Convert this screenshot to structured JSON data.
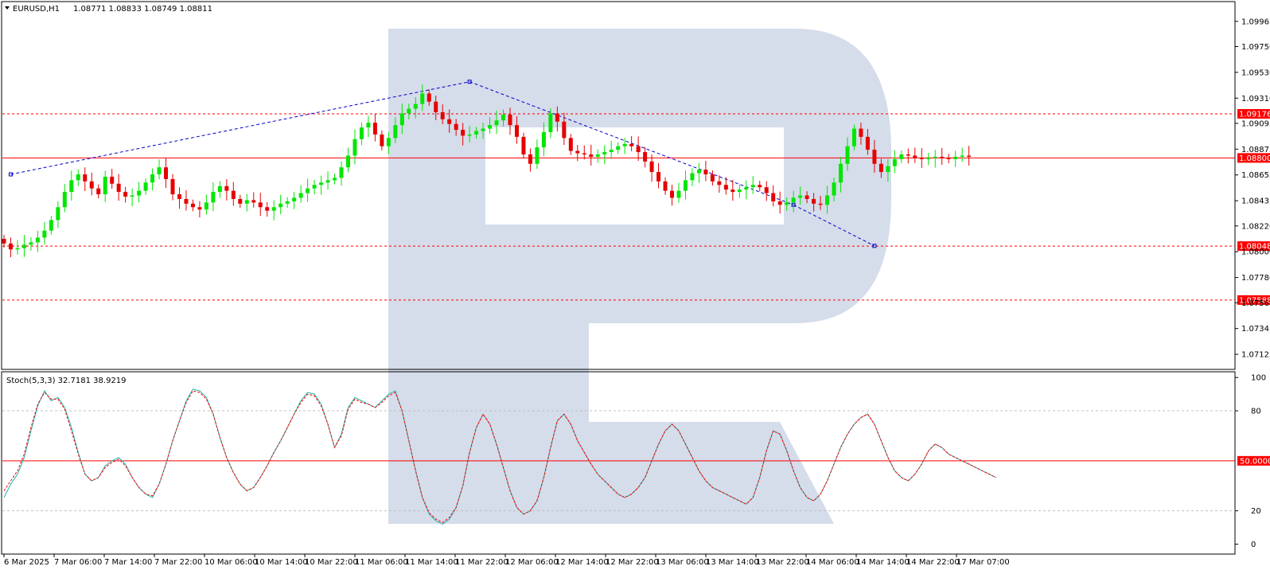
{
  "header": {
    "symbol": "EURUSD,H1",
    "ohlc": "1.08771 1.08833 1.08749 1.08811"
  },
  "stoch_header": "Stoch(5,3,3) 32.7181 38.9219",
  "colors": {
    "bull": "#00e600",
    "bear": "#e60000",
    "hline": "#ff0000",
    "pattern": "#0000cc",
    "stoch_main": "#20b2aa",
    "stoch_signal": "#ff0000",
    "watermark": "#d5dcea"
  },
  "chart_data": [
    {
      "type": "candlestick",
      "symbol": "EURUSD",
      "timeframe": "H1",
      "ylim": [
        1.0701,
        1.1012
      ],
      "yticks": [
        "1.09965",
        "1.09750",
        "1.09530",
        "1.09310",
        "1.09095",
        "1.08875",
        "1.08655",
        "1.08435",
        "1.08220",
        "1.08000",
        "1.07780",
        "1.07565",
        "1.07345",
        "1.07125"
      ],
      "xticks": [
        "6 Mar 2025",
        "7 Mar 06:00",
        "7 Mar 14:00",
        "7 Mar 22:00",
        "10 Mar 06:00",
        "10 Mar 14:00",
        "10 Mar 22:00",
        "11 Mar 06:00",
        "11 Mar 14:00",
        "11 Mar 22:00",
        "12 Mar 06:00",
        "12 Mar 14:00",
        "12 Mar 22:00",
        "13 Mar 06:00",
        "13 Mar 14:00",
        "13 Mar 22:00",
        "14 Mar 06:00",
        "14 Mar 14:00",
        "14 Mar 22:00",
        "17 Mar 07:00"
      ],
      "price_levels": [
        {
          "value": 1.09176,
          "label": "1.09176",
          "style": "dashed"
        },
        {
          "value": 1.088,
          "label": "1.08800",
          "style": "solid"
        },
        {
          "value": 1.08048,
          "label": "1.08048",
          "style": "dashed"
        },
        {
          "value": 1.07588,
          "label": "1.07588",
          "style": "dashed"
        }
      ],
      "pattern_points": [
        {
          "pt": [
            1,
            1.0866
          ],
          "style": "dashed"
        },
        {
          "pt": [
            69,
            1.0945
          ],
          "style": "dashed"
        },
        {
          "pt": [
            117,
            1.084
          ],
          "style": "dashed"
        },
        {
          "pt": [
            129,
            1.0805
          ],
          "style": "dashed"
        }
      ],
      "close_series": [
        1.0807,
        1.0802,
        1.0803,
        1.0806,
        1.0808,
        1.0812,
        1.0818,
        1.0827,
        1.0838,
        1.0851,
        1.0861,
        1.0866,
        1.086,
        1.0854,
        1.0849,
        1.0864,
        1.0858,
        1.0851,
        1.0847,
        1.0848,
        1.0852,
        1.0859,
        1.0866,
        1.0872,
        1.0862,
        1.0849,
        1.0845,
        1.0841,
        1.0838,
        1.0836,
        1.0842,
        1.0851,
        1.0856,
        1.0852,
        1.0845,
        1.0841,
        1.0844,
        1.0842,
        1.0838,
        1.0835,
        1.0838,
        1.0841,
        1.0843,
        1.0846,
        1.085,
        1.0854,
        1.0857,
        1.0859,
        1.0861,
        1.0863,
        1.0872,
        1.0882,
        1.0896,
        1.0906,
        1.091,
        1.09,
        1.089,
        1.0897,
        1.0908,
        1.0918,
        1.0922,
        1.0926,
        1.0935,
        1.0928,
        1.0919,
        1.0913,
        1.0909,
        1.0904,
        1.0899,
        1.09,
        1.0903,
        1.0905,
        1.0908,
        1.0912,
        1.0917,
        1.0908,
        1.0898,
        1.0883,
        1.0875,
        1.0889,
        1.0902,
        1.0918,
        1.0911,
        1.0897,
        1.0886,
        1.0884,
        1.0883,
        1.0881,
        1.0883,
        1.0885,
        1.0887,
        1.089,
        1.0892,
        1.089,
        1.0885,
        1.0877,
        1.0868,
        1.086,
        1.0852,
        1.0846,
        1.0852,
        1.0861,
        1.0867,
        1.087,
        1.0866,
        1.086,
        1.0857,
        1.0853,
        1.0851,
        1.0853,
        1.0855,
        1.0857,
        1.0855,
        1.085,
        1.0843,
        1.084,
        1.0842,
        1.0846,
        1.0848,
        1.0845,
        1.0841,
        1.084,
        1.0848,
        1.0859,
        1.0875,
        1.089,
        1.0905,
        1.0898,
        1.0887,
        1.0875,
        1.0868,
        1.0873,
        1.0879,
        1.0883,
        1.0882,
        1.088,
        1.0879,
        1.088,
        1.0881,
        1.088,
        1.0879,
        1.0881,
        1.0882,
        1.0881
      ]
    },
    {
      "type": "line",
      "title": "Stoch(5,3,3) 32.7181 38.9219",
      "ylim": [
        -5,
        102
      ],
      "yticks": [
        "100",
        "80",
        "20",
        "0"
      ],
      "levels": [
        {
          "value": 80,
          "style": "dashed"
        },
        {
          "value": 50,
          "label": "50.0000",
          "style": "solid"
        },
        {
          "value": 20,
          "style": "dashed"
        }
      ],
      "series": [
        {
          "values": [
            28,
            36,
            42,
            52,
            68,
            83,
            92,
            86,
            88,
            82,
            70,
            55,
            42,
            38,
            40,
            47,
            50,
            52,
            48,
            40,
            34,
            30,
            28,
            36,
            48,
            62,
            74,
            86,
            93,
            92,
            88,
            78,
            64,
            52,
            43,
            36,
            32,
            34,
            40,
            47,
            55,
            62,
            70,
            78,
            86,
            91,
            90,
            84,
            72,
            58,
            66,
            82,
            88,
            86,
            84,
            82,
            86,
            90,
            92,
            80,
            62,
            44,
            28,
            18,
            14,
            12,
            15,
            22,
            35,
            55,
            70,
            78,
            72,
            60,
            46,
            32,
            22,
            18,
            20,
            26,
            40,
            58,
            74,
            78,
            72,
            62,
            55,
            48,
            42,
            38,
            34,
            30,
            28,
            30,
            34,
            40,
            50,
            60,
            68,
            72,
            68,
            60,
            52,
            44,
            38,
            34,
            32,
            30,
            28,
            26,
            24,
            28,
            40,
            56,
            68,
            66,
            56,
            44,
            34,
            28,
            26,
            30,
            38,
            48,
            58,
            66,
            72,
            76,
            78,
            72,
            62,
            52,
            44,
            40,
            38,
            42,
            48,
            56,
            60,
            58,
            54,
            52,
            50,
            48,
            46,
            44,
            42,
            40
          ]
        },
        {
          "values": [
            32,
            38,
            44,
            54,
            70,
            84,
            91,
            87,
            87,
            81,
            68,
            54,
            42,
            38,
            40,
            46,
            49,
            51,
            47,
            40,
            34,
            30,
            29,
            36,
            48,
            62,
            74,
            85,
            92,
            91,
            87,
            78,
            64,
            52,
            43,
            36,
            32,
            34,
            40,
            47,
            55,
            62,
            70,
            78,
            85,
            90,
            89,
            83,
            72,
            58,
            65,
            81,
            87,
            85,
            84,
            82,
            85,
            89,
            91,
            80,
            62,
            44,
            28,
            19,
            15,
            13,
            16,
            22,
            35,
            55,
            70,
            78,
            72,
            60,
            46,
            32,
            22,
            18,
            20,
            26,
            40,
            58,
            74,
            78,
            72,
            62,
            55,
            48,
            42,
            38,
            34,
            30,
            28,
            30,
            34,
            40,
            50,
            60,
            68,
            72,
            68,
            60,
            52,
            44,
            38,
            34,
            32,
            30,
            28,
            26,
            24,
            28,
            40,
            56,
            68,
            66,
            56,
            44,
            34,
            28,
            26,
            30,
            38,
            48,
            58,
            66,
            72,
            76,
            78,
            72,
            62,
            52,
            44,
            40,
            38,
            42,
            48,
            56,
            60,
            58,
            54,
            52,
            50,
            48,
            46,
            44,
            42,
            40
          ]
        }
      ]
    }
  ]
}
